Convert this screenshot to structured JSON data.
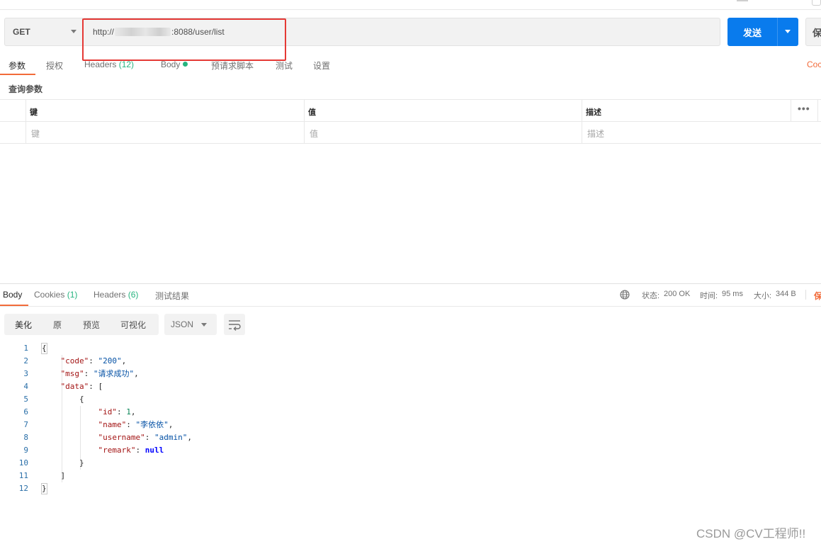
{
  "request": {
    "method": "GET",
    "url_prefix": "http://",
    "url_suffix": ":8088/user/list",
    "send_label": "发送",
    "save_label": "保"
  },
  "request_tabs": [
    {
      "label": "参数",
      "active": true
    },
    {
      "label": "授权"
    },
    {
      "label": "Headers",
      "count": "(12)"
    },
    {
      "label": "Body"
    },
    {
      "label": "预请求脚本"
    },
    {
      "label": "测试"
    },
    {
      "label": "设置"
    }
  ],
  "code_link": "Coc",
  "params": {
    "section_label": "查询参数",
    "headers": [
      "键",
      "值",
      "描述"
    ],
    "placeholders": [
      "键",
      "值",
      "描述"
    ],
    "more": "•••"
  },
  "response_tabs": [
    {
      "label": "Body",
      "active": true
    },
    {
      "label": "Cookies",
      "count": "(1)"
    },
    {
      "label": "Headers",
      "count": "(6)"
    },
    {
      "label": "测试结果"
    }
  ],
  "status": {
    "status_label": "状态:",
    "status_value": "200 OK",
    "time_label": "时间:",
    "time_value": "95 ms",
    "size_label": "大小:",
    "size_value": "344 B",
    "save_label": "保"
  },
  "view_modes": [
    "美化",
    "原",
    "预览",
    "可视化"
  ],
  "format": "JSON",
  "colors": {
    "accent": "#f26b3a",
    "primary": "#097bed",
    "success": "#26b47f",
    "highlight": "#e53935"
  },
  "icons": {
    "globe": "globe-icon",
    "wrap": "wrap-lines-icon"
  },
  "code_lines": [
    {
      "n": "1",
      "t": "{"
    },
    {
      "n": "2",
      "k": "\"code\"",
      "sep": ": ",
      "v": "\"200\"",
      "vt": "str",
      "end": ","
    },
    {
      "n": "3",
      "k": "\"msg\"",
      "sep": ": ",
      "v": "\"请求成功\"",
      "vt": "str",
      "end": ","
    },
    {
      "n": "4",
      "k": "\"data\"",
      "sep": ": ",
      "v": "[",
      "vt": "plain"
    },
    {
      "n": "5",
      "t": "{"
    },
    {
      "n": "6",
      "k": "\"id\"",
      "sep": ": ",
      "v": "1",
      "vt": "num",
      "end": ","
    },
    {
      "n": "7",
      "k": "\"name\"",
      "sep": ": ",
      "v": "\"李依依\"",
      "vt": "str",
      "end": ","
    },
    {
      "n": "8",
      "k": "\"username\"",
      "sep": ": ",
      "v": "\"admin\"",
      "vt": "str",
      "end": ","
    },
    {
      "n": "9",
      "k": "\"remark\"",
      "sep": ": ",
      "v": "null",
      "vt": "kw"
    },
    {
      "n": "10",
      "t": "}"
    },
    {
      "n": "11",
      "t": "]"
    },
    {
      "n": "12",
      "t": "}"
    }
  ],
  "watermark": "CSDN @CV工程师!!"
}
